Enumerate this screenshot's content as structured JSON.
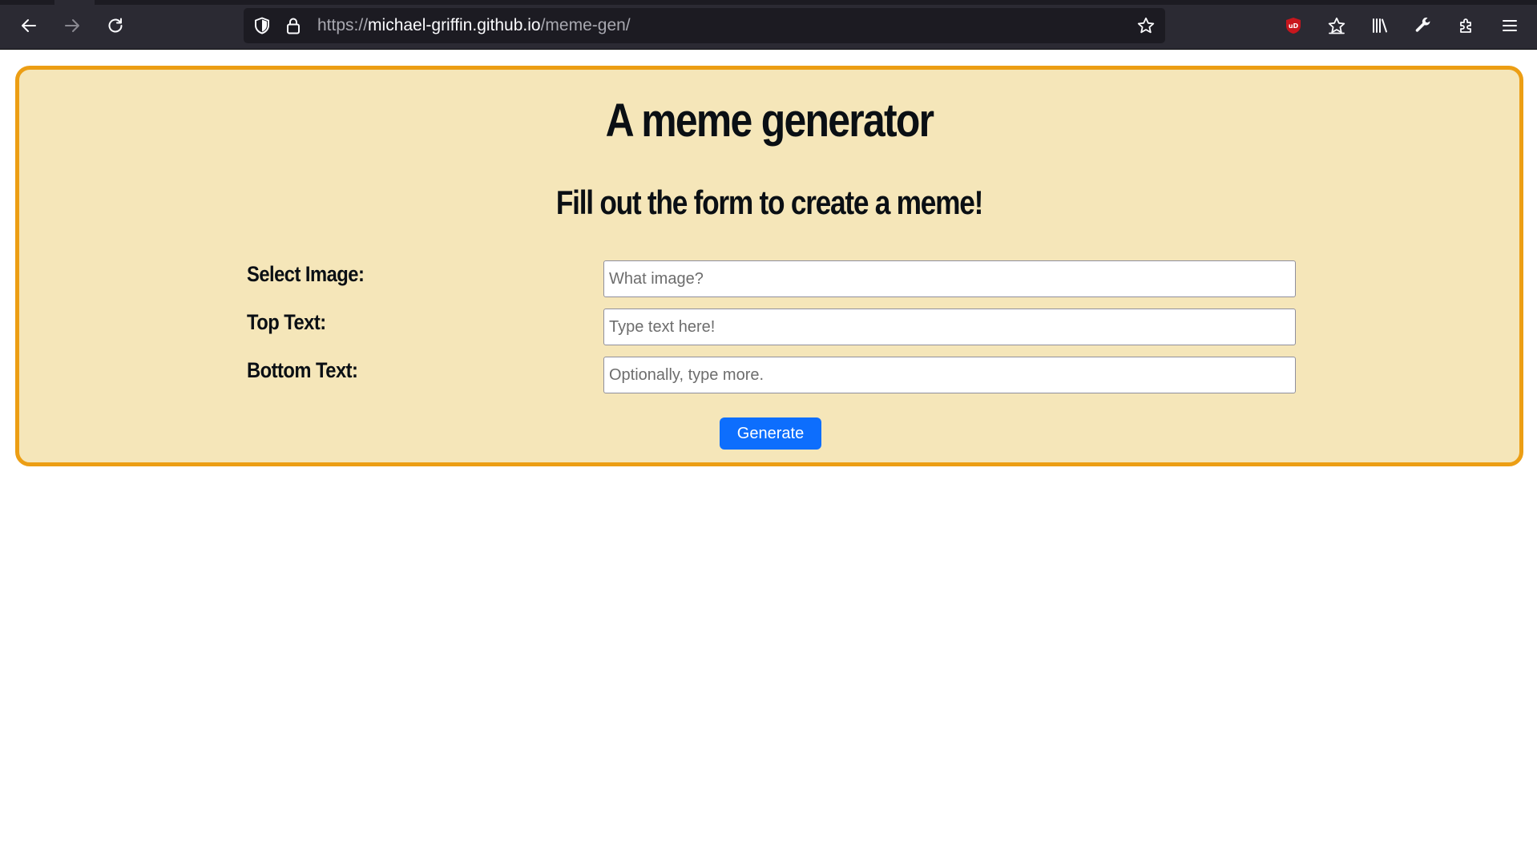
{
  "browser": {
    "url_prefix": "https://",
    "url_host": "michael-griffin.github.io",
    "url_path": "/meme-gen/",
    "icons": {
      "back": "back-arrow-icon",
      "forward": "forward-arrow-icon",
      "reload": "reload-icon",
      "tracking_protection": "shield-icon",
      "secure": "lock-icon",
      "bookmark": "star-icon",
      "ublock": "ublock-origin-icon",
      "bookmarks_menu": "bookmarks-star-icon",
      "library": "library-icon",
      "devtools": "wrench-icon",
      "extensions": "puzzle-icon",
      "menu": "hamburger-menu-icon"
    }
  },
  "page": {
    "title": "A meme generator",
    "subtitle": "Fill out the form to create a meme!",
    "form": {
      "image_label": "Select Image:",
      "image_placeholder": "What image?",
      "image_value": "",
      "top_label": "Top Text:",
      "top_placeholder": "Type text here!",
      "top_value": "",
      "bottom_label": "Bottom Text:",
      "bottom_placeholder": "Optionally, type more.",
      "bottom_value": "",
      "submit_label": "Generate"
    }
  },
  "colors": {
    "card_background": "#f5e6b9",
    "card_border": "#ec9e14",
    "button_primary": "#0d6efd",
    "toolbar": "#2b2a33"
  }
}
